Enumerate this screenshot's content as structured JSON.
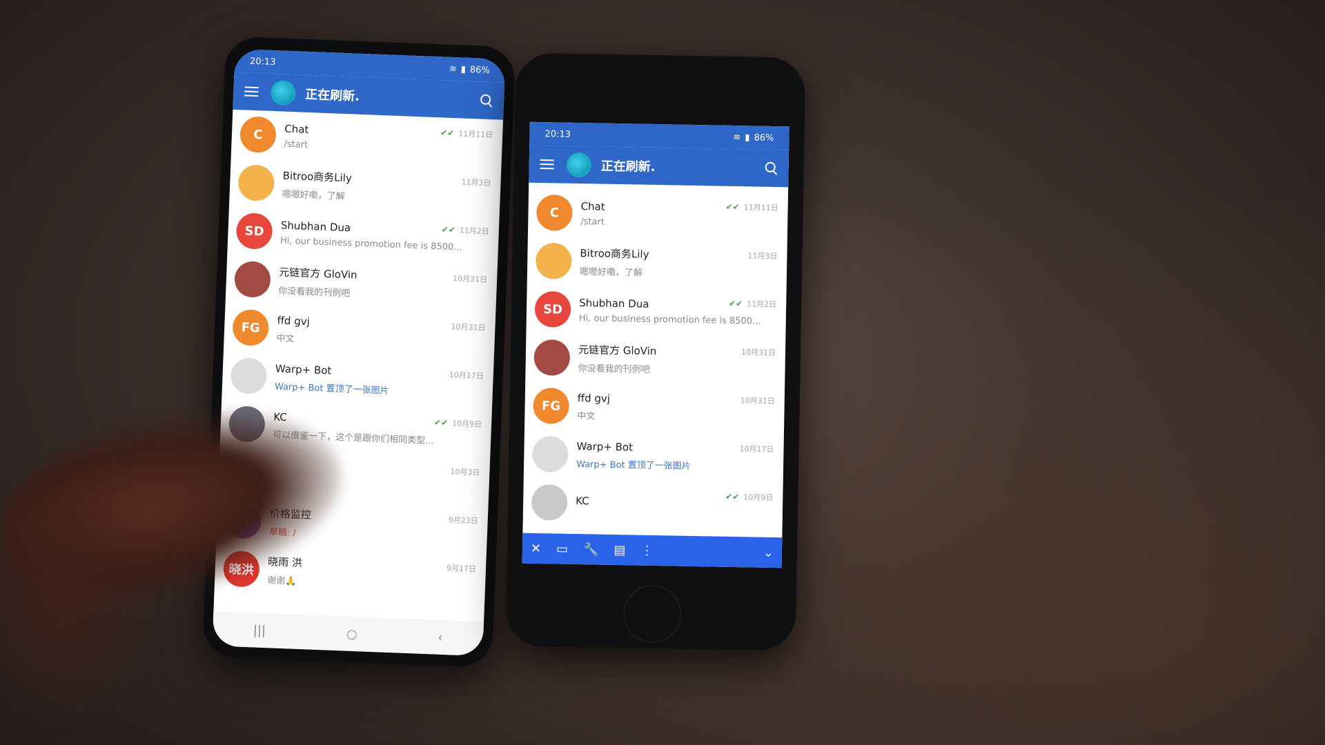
{
  "status": {
    "time": "20:13",
    "battery": "86%"
  },
  "app": {
    "title": "正在刷新."
  },
  "left_chats": [
    {
      "initials": "C",
      "name": "Chat",
      "message": "/start",
      "date": "11月11日",
      "color": "#f0892e",
      "check": "✔✔",
      "style": ""
    },
    {
      "initials": "",
      "name": "Bitroo商务Lily",
      "message": "嗯嗯好嘞，了解",
      "date": "11月3日",
      "color": "#f3b24a",
      "check": "",
      "style": ""
    },
    {
      "initials": "SD",
      "name": "Shubhan Dua",
      "message": "Hi, our business promotion fee is 8500...",
      "date": "11月2日",
      "color": "#e6463b",
      "check": "✔✔",
      "style": ""
    },
    {
      "initials": "",
      "name": "元链官方 GloVin",
      "message": "你没看我的刊例吧",
      "date": "10月31日",
      "color": "#a24a44",
      "check": "",
      "style": ""
    },
    {
      "initials": "FG",
      "name": "ffd gvj",
      "message": "中文",
      "date": "10月31日",
      "color": "#f0892e",
      "check": "",
      "style": ""
    },
    {
      "initials": "",
      "name": "Warp+ Bot",
      "message": "Warp+ Bot 置顶了一张图片",
      "date": "10月17日",
      "color": "#dcdcdc",
      "check": "",
      "style": "link"
    },
    {
      "initials": "",
      "name": "KC",
      "message": "可以借鉴一下，这个是跟你们相同类型...",
      "date": "10月9日",
      "color": "#6b6b7a",
      "check": "✔✔",
      "style": ""
    },
    {
      "initials": "",
      "name": "",
      "message": "",
      "date": "10月3日",
      "color": "#ffffff",
      "check": "",
      "style": ""
    },
    {
      "initials": "价",
      "name": "价格监控",
      "message": "草稿: /",
      "date": "9月23日",
      "color": "#7a4bd6",
      "check": "",
      "style": "draft"
    },
    {
      "initials": "晓洪",
      "name": "晓雨 洪",
      "message": "谢谢🙏",
      "date": "9月17日",
      "color": "#e0362e",
      "check": "",
      "style": ""
    }
  ],
  "right_chats": [
    {
      "initials": "C",
      "name": "Chat",
      "message": "/start",
      "date": "11月11日",
      "color": "#f0892e",
      "check": "✔✔",
      "style": ""
    },
    {
      "initials": "",
      "name": "Bitroo商务Lily",
      "message": "嗯嗯好嘞，了解",
      "date": "11月3日",
      "color": "#f3b24a",
      "check": "",
      "style": ""
    },
    {
      "initials": "SD",
      "name": "Shubhan Dua",
      "message": "Hi, our business promotion fee is 8500...",
      "date": "11月2日",
      "color": "#e6463b",
      "check": "✔✔",
      "style": ""
    },
    {
      "initials": "",
      "name": "元链官方 GloVin",
      "message": "你没看我的刊例吧",
      "date": "10月31日",
      "color": "#a24a44",
      "check": "",
      "style": ""
    },
    {
      "initials": "FG",
      "name": "ffd gvj",
      "message": "中文",
      "date": "10月31日",
      "color": "#f0892e",
      "check": "",
      "style": ""
    },
    {
      "initials": "",
      "name": "Warp+ Bot",
      "message": "Warp+ Bot 置顶了一张图片",
      "date": "10月17日",
      "color": "#dcdcdc",
      "check": "",
      "style": "link"
    },
    {
      "initials": "",
      "name": "KC",
      "message": "",
      "date": "10月9日",
      "color": "#c9c9c9",
      "check": "✔✔",
      "style": ""
    }
  ],
  "navbar": {
    "recent": "|||",
    "home": "○",
    "back": "‹"
  },
  "toolbar": {
    "close": "✕",
    "screen": "▭",
    "wrench": "🔧",
    "chat": "▤",
    "more": "⋮",
    "collapse": "⌄"
  }
}
